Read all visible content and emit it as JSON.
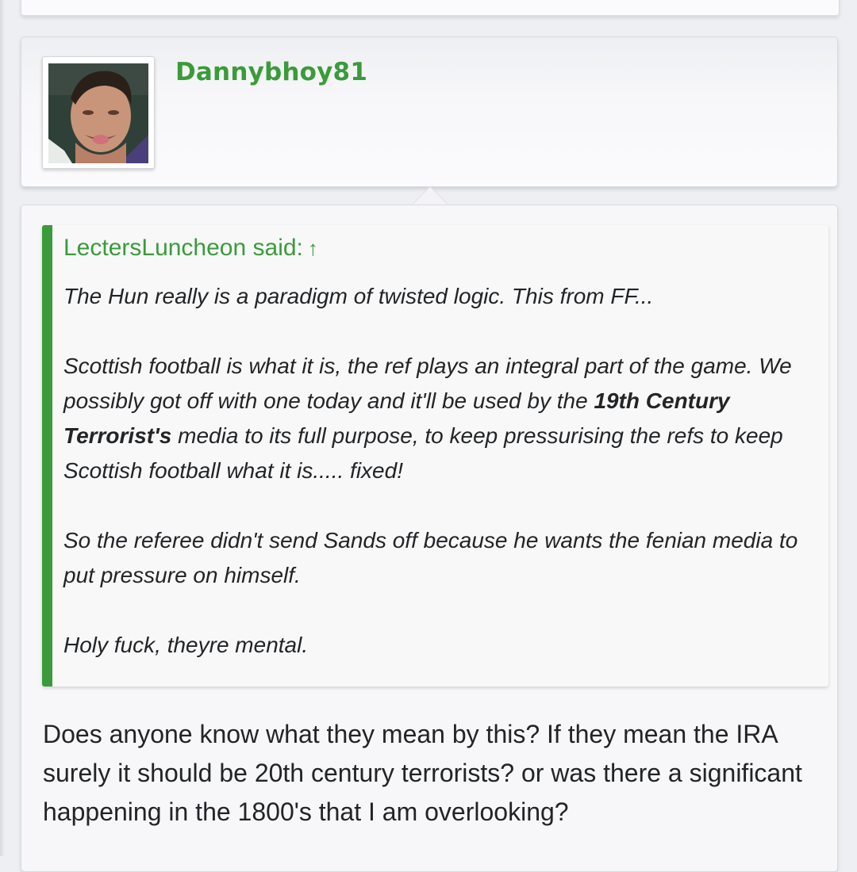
{
  "post": {
    "username": "Dannybhoy81",
    "avatar": "user-avatar-photo",
    "colors": {
      "accent": "#3a9b3a",
      "text": "#222426",
      "card": "#f7f7f9"
    }
  },
  "quote": {
    "attribution": "LectersLuncheon said:",
    "arrow": "↑",
    "p1": "The Hun really is a paradigm of twisted logic. This from FF...",
    "p2_before": "Scottish football is what it is, the ref plays an integral part of the game. We possibly got off with one today and it'll be used by the ",
    "p2_bold": "19th Century Terrorist's",
    "p2_after": " media to its full purpose, to keep pressurising the refs to keep Scottish football what it is..... fixed!",
    "p3": "So the referee didn't send Sands off because he wants the fenian media to put pressure on himself.",
    "p4": "Holy fuck, theyre mental."
  },
  "reply": {
    "text": "Does anyone know what they mean by this? If they mean the IRA surely it should be 20th century terrorists? or was there a significant happening in the 1800's that I am overlooking?"
  }
}
